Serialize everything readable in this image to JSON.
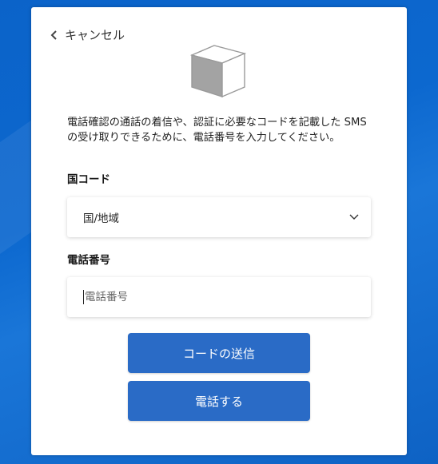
{
  "card": {
    "cancel_label": "キャンセル",
    "description": "電話確認の通話の着信や、認証に必要なコードを記載した SMS の受け取りできるために、電話番号を入力してください。",
    "country_code_label": "国コード",
    "country_select_value": "国/地域",
    "phone_label": "電話番号",
    "phone_placeholder": "電話番号",
    "phone_value": "",
    "send_code_label": "コードの送信",
    "call_label": "電話する"
  },
  "icons": {
    "back": "chevron-left-icon",
    "hero": "cube-icon",
    "select": "chevron-down-icon"
  },
  "colors": {
    "background": "#0c68cf",
    "button": "#2a6bc6",
    "card": "#ffffff"
  }
}
